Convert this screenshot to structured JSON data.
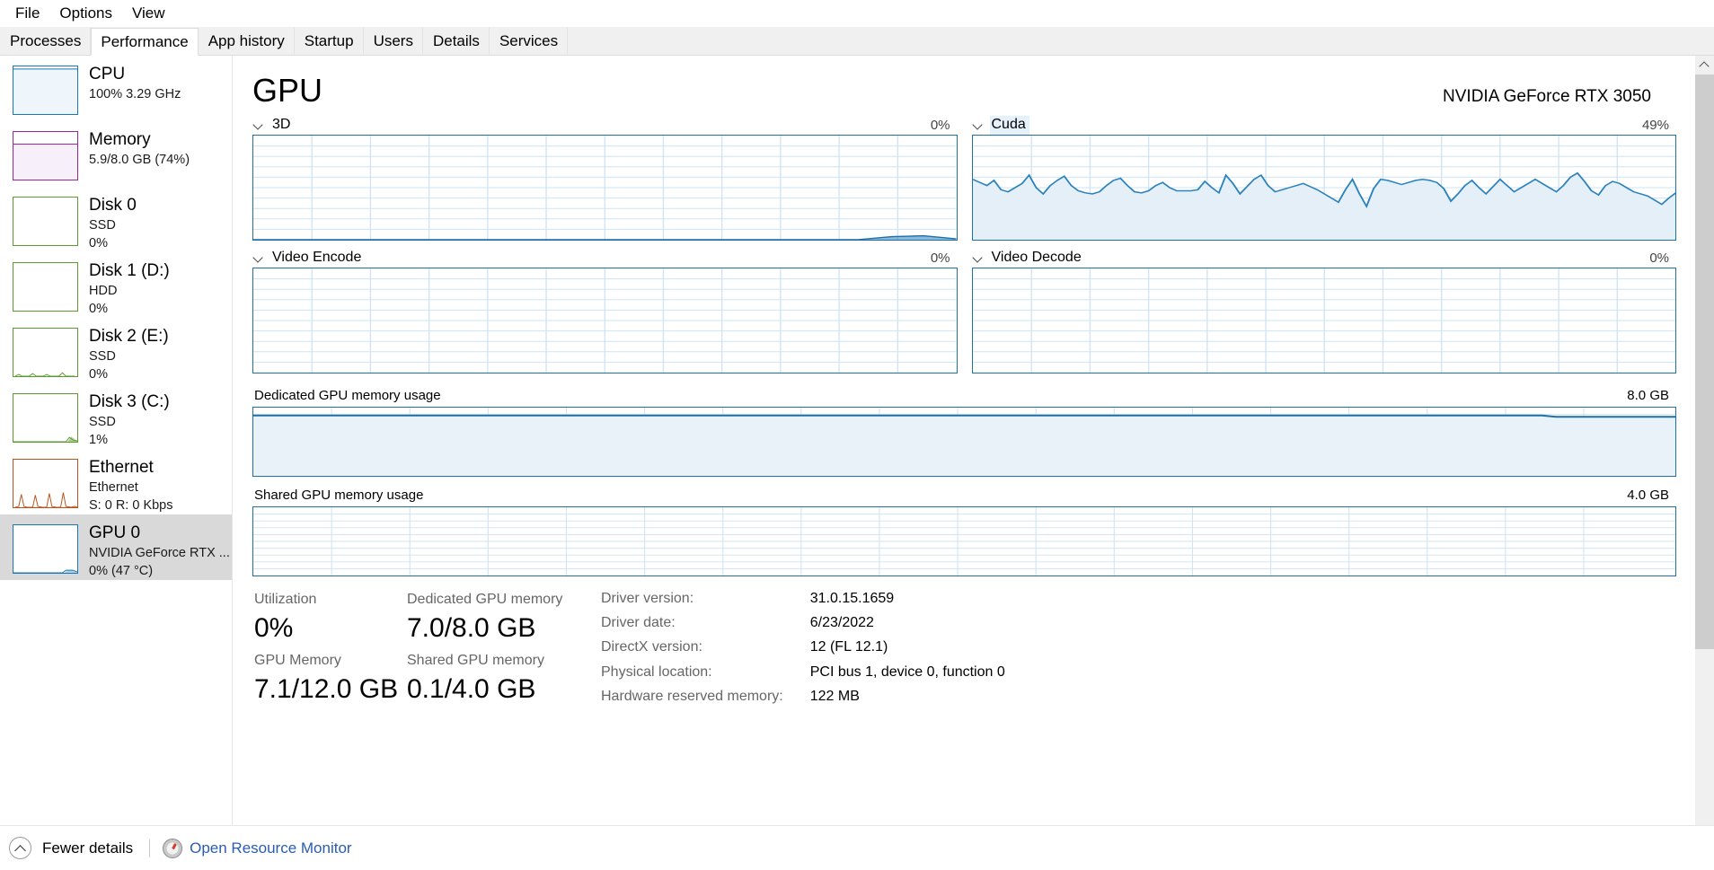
{
  "menu": {
    "items": [
      {
        "label": "File"
      },
      {
        "label": "Options"
      },
      {
        "label": "View"
      }
    ]
  },
  "tabs": [
    {
      "label": "Processes",
      "active": false
    },
    {
      "label": "Performance",
      "active": true
    },
    {
      "label": "App history",
      "active": false
    },
    {
      "label": "Startup",
      "active": false
    },
    {
      "label": "Users",
      "active": false
    },
    {
      "label": "Details",
      "active": false
    },
    {
      "label": "Services",
      "active": false
    }
  ],
  "sidebar": {
    "items": [
      {
        "name": "cpu",
        "title": "CPU",
        "sub1": "100%  3.29 GHz",
        "sub2": "",
        "color": "#1877b5",
        "fill": "#eef5fb",
        "selected": false,
        "graph": "flat-full"
      },
      {
        "name": "memory",
        "title": "Memory",
        "sub1": "5.9/8.0 GB (74%)",
        "sub2": "",
        "color": "#9b24a0",
        "fill": "#f7effa",
        "selected": false,
        "graph": "mem-74"
      },
      {
        "name": "disk-0",
        "title": "Disk 0",
        "sub1": "SSD",
        "sub2": "0%",
        "color": "#5b9b2e",
        "fill": "#ffffff",
        "selected": false,
        "graph": "empty"
      },
      {
        "name": "disk-1",
        "title": "Disk 1 (D:)",
        "sub1": "HDD",
        "sub2": "0%",
        "color": "#5b9b2e",
        "fill": "#ffffff",
        "selected": false,
        "graph": "empty"
      },
      {
        "name": "disk-2",
        "title": "Disk 2 (E:)",
        "sub1": "SSD",
        "sub2": "0%",
        "color": "#5b9b2e",
        "fill": "#ffffff",
        "selected": false,
        "graph": "tiny-spikes"
      },
      {
        "name": "disk-3",
        "title": "Disk 3 (C:)",
        "sub1": "SSD",
        "sub2": "1%",
        "color": "#5b9b2e",
        "fill": "#ffffff",
        "selected": false,
        "graph": "corner-blip"
      },
      {
        "name": "ethernet",
        "title": "Ethernet",
        "sub1": "Ethernet",
        "sub2": "S: 0  R: 0 Kbps",
        "color": "#b8541b",
        "fill": "#ffffff",
        "selected": false,
        "graph": "net-spikes"
      },
      {
        "name": "gpu-0",
        "title": "GPU 0",
        "sub1": "NVIDIA GeForce RTX ...",
        "sub2": "0%  (47 °C)",
        "color": "#1877b5",
        "fill": "#ffffff",
        "selected": true,
        "graph": "gpu-blip"
      }
    ]
  },
  "main": {
    "title": "GPU",
    "device": "NVIDIA GeForce RTX 3050",
    "graphs": [
      {
        "name": "3d",
        "label": "3D",
        "percent": "0%",
        "hovered": false
      },
      {
        "name": "cuda",
        "label": "Cuda",
        "percent": "49%",
        "hovered": true
      },
      {
        "name": "video-encode",
        "label": "Video Encode",
        "percent": "0%",
        "hovered": false
      },
      {
        "name": "video-decode",
        "label": "Video Decode",
        "percent": "0%",
        "hovered": false
      }
    ],
    "memory_graphs": [
      {
        "name": "dedicated-gpu-memory-usage",
        "label": "Dedicated GPU memory usage",
        "max": "8.0 GB"
      },
      {
        "name": "shared-gpu-memory-usage",
        "label": "Shared GPU memory usage",
        "max": "4.0 GB"
      }
    ],
    "stats": [
      {
        "label": "Utilization",
        "value": "0%"
      },
      {
        "label": "GPU Memory",
        "value": "7.1/12.0 GB"
      },
      {
        "label": "Dedicated GPU memory",
        "value": "7.0/8.0 GB"
      },
      {
        "label": "Shared GPU memory",
        "value": "0.1/4.0 GB"
      }
    ],
    "info": [
      {
        "key": "Driver version:",
        "value": "31.0.15.1659"
      },
      {
        "key": "Driver date:",
        "value": "6/23/2022"
      },
      {
        "key": "DirectX version:",
        "value": "12 (FL 12.1)"
      },
      {
        "key": "Physical location:",
        "value": "PCI bus 1, device 0, function 0"
      },
      {
        "key": "Hardware reserved memory:",
        "value": "122 MB"
      }
    ]
  },
  "footer": {
    "fewer_details": "Fewer details",
    "resource_monitor": "Open Resource Monitor"
  },
  "chart_data": [
    {
      "type": "area",
      "name": "3d",
      "title": "3D",
      "ylabel": "Utilization",
      "ylim": [
        0,
        100
      ],
      "current": 0,
      "grid": true,
      "line_color": "#1f6fa8",
      "fill_color": "#e9f2f9",
      "values": [
        0,
        0,
        0,
        0,
        0,
        0,
        0,
        0,
        0,
        0,
        0,
        0,
        0,
        0,
        0,
        0,
        0,
        0,
        0,
        0,
        0,
        0,
        0,
        0,
        0,
        0,
        0,
        0,
        0,
        0,
        0,
        0,
        0,
        0,
        0,
        0,
        0,
        0,
        0,
        0,
        0,
        0,
        0,
        0,
        0,
        0,
        0,
        0,
        0,
        0,
        0,
        0,
        0,
        0,
        0,
        0,
        0,
        0,
        0,
        0,
        0,
        0,
        0,
        0,
        0,
        0,
        0,
        0,
        0,
        0,
        0,
        0,
        0,
        0,
        0,
        0,
        0,
        0,
        0,
        0,
        0,
        0,
        0,
        0,
        0,
        0,
        0,
        0,
        0,
        0,
        0,
        0,
        0,
        0,
        0,
        0,
        2,
        3,
        2,
        0
      ]
    },
    {
      "type": "area",
      "name": "cuda",
      "title": "Cuda",
      "ylabel": "Utilization",
      "ylim": [
        0,
        100
      ],
      "current": 49,
      "grid": true,
      "line_color": "#1f6fa8",
      "fill_color": "#e9f2f9",
      "values": [
        58,
        55,
        52,
        57,
        48,
        46,
        50,
        54,
        62,
        50,
        44,
        52,
        57,
        61,
        52,
        47,
        45,
        44,
        46,
        52,
        57,
        59,
        52,
        46,
        45,
        47,
        52,
        55,
        50,
        47,
        47,
        47,
        48,
        56,
        50,
        45,
        62,
        54,
        44,
        51,
        58,
        62,
        52,
        46,
        48,
        50,
        52,
        54,
        51,
        48,
        44,
        40,
        36,
        48,
        58,
        44,
        32,
        49,
        58,
        57,
        55,
        53,
        55,
        57,
        58,
        57,
        55,
        49,
        37,
        44,
        52,
        57,
        50,
        44,
        51,
        58,
        52,
        46,
        50,
        54,
        58,
        54,
        50,
        46,
        52,
        60,
        64,
        56,
        47,
        43,
        52,
        56,
        54,
        50,
        46,
        44,
        42,
        38,
        34,
        40,
        45
      ]
    },
    {
      "type": "area",
      "name": "video-encode",
      "title": "Video Encode",
      "ylabel": "Utilization",
      "ylim": [
        0,
        100
      ],
      "current": 0,
      "grid": true,
      "line_color": "#1f6fa8",
      "fill_color": "#e9f2f9",
      "values": [
        0,
        0,
        0,
        0,
        0,
        0,
        0,
        0,
        0,
        0,
        0,
        0,
        0,
        0,
        0,
        0,
        0,
        0,
        0,
        0,
        0,
        0,
        0,
        0,
        0,
        0,
        0,
        0,
        0,
        0,
        0,
        0,
        0,
        0,
        0,
        0,
        0,
        0,
        0,
        0,
        0,
        0,
        0,
        0,
        0,
        0,
        0,
        0,
        0,
        0
      ]
    },
    {
      "type": "area",
      "name": "video-decode",
      "title": "Video Decode",
      "ylabel": "Utilization",
      "ylim": [
        0,
        100
      ],
      "current": 0,
      "grid": true,
      "line_color": "#1f6fa8",
      "fill_color": "#e9f2f9",
      "values": [
        0,
        0,
        0,
        0,
        0,
        0,
        0,
        0,
        0,
        0,
        0,
        0,
        0,
        0,
        0,
        0,
        0,
        0,
        0,
        0,
        0,
        0,
        0,
        0,
        0,
        0,
        0,
        0,
        0,
        0,
        0,
        0,
        0,
        0,
        0,
        0,
        0,
        0,
        0,
        0,
        0,
        0,
        0,
        0,
        0,
        0,
        0,
        0,
        0,
        0
      ]
    },
    {
      "type": "area",
      "name": "dedicated-gpu-memory-usage",
      "title": "Dedicated GPU memory usage",
      "ylabel": "GB",
      "ylim": [
        0,
        8.0
      ],
      "ymax_label": "8.0 GB",
      "current": 7.0,
      "grid": true,
      "line_color": "#1f6fa8",
      "fill_color": "#eef4fa",
      "values": [
        7.02,
        7.02,
        7.02,
        7.02,
        7.02,
        7.02,
        7.02,
        7.02,
        7.02,
        7.02,
        7.02,
        7.02,
        7.02,
        7.02,
        7.02,
        7.02,
        7.02,
        7.02,
        7.02,
        7.02,
        7.02,
        7.02,
        7.02,
        7.02,
        7.02,
        7.02,
        7.02,
        7.02,
        7.02,
        7.02,
        7.02,
        7.02,
        7.02,
        7.02,
        7.02,
        7.02,
        7.02,
        7.02,
        7.02,
        7.02,
        7.02,
        7.02,
        7.02,
        7.02,
        7.02,
        7.02,
        7.02,
        7.02,
        7.02,
        7.02,
        7.02,
        7.02,
        7.02,
        7.02,
        7.02,
        7.02,
        7.02,
        7.02,
        7.02,
        7.02,
        7.02,
        7.02,
        7.02,
        7.02,
        7.02,
        7.02,
        7.02,
        7.02,
        7.02,
        7.02,
        7.02,
        7.02,
        7.02,
        7.02,
        7.02,
        7.02,
        7.02,
        7.02,
        7.02,
        7.02,
        7.02,
        7.02,
        7.02,
        7.02,
        7.02,
        7.02,
        7.0,
        6.98,
        6.99,
        7.0,
        7.0,
        7.0,
        7.0,
        7.0,
        7.0,
        7.0,
        7.0,
        7.0,
        7.0,
        7.0,
        7.0
      ]
    },
    {
      "type": "area",
      "name": "shared-gpu-memory-usage",
      "title": "Shared GPU memory usage",
      "ylabel": "GB",
      "ylim": [
        0,
        4.0
      ],
      "ymax_label": "4.0 GB",
      "current": 0.1,
      "grid": true,
      "line_color": "#1f6fa8",
      "fill_color": "#eef4fa",
      "values": [
        0.1,
        0.1,
        0.1,
        0.1,
        0.1,
        0.1,
        0.1,
        0.1,
        0.1,
        0.1,
        0.1,
        0.1,
        0.1,
        0.1,
        0.1,
        0.1,
        0.1,
        0.1,
        0.1,
        0.1,
        0.1,
        0.1,
        0.1,
        0.1,
        0.1,
        0.1,
        0.1,
        0.1,
        0.1,
        0.1,
        0.1,
        0.1,
        0.1,
        0.1,
        0.1,
        0.1,
        0.1,
        0.1,
        0.1,
        0.1,
        0.1,
        0.1,
        0.1,
        0.1,
        0.1,
        0.1,
        0.1,
        0.1,
        0.1,
        0.1
      ]
    }
  ]
}
